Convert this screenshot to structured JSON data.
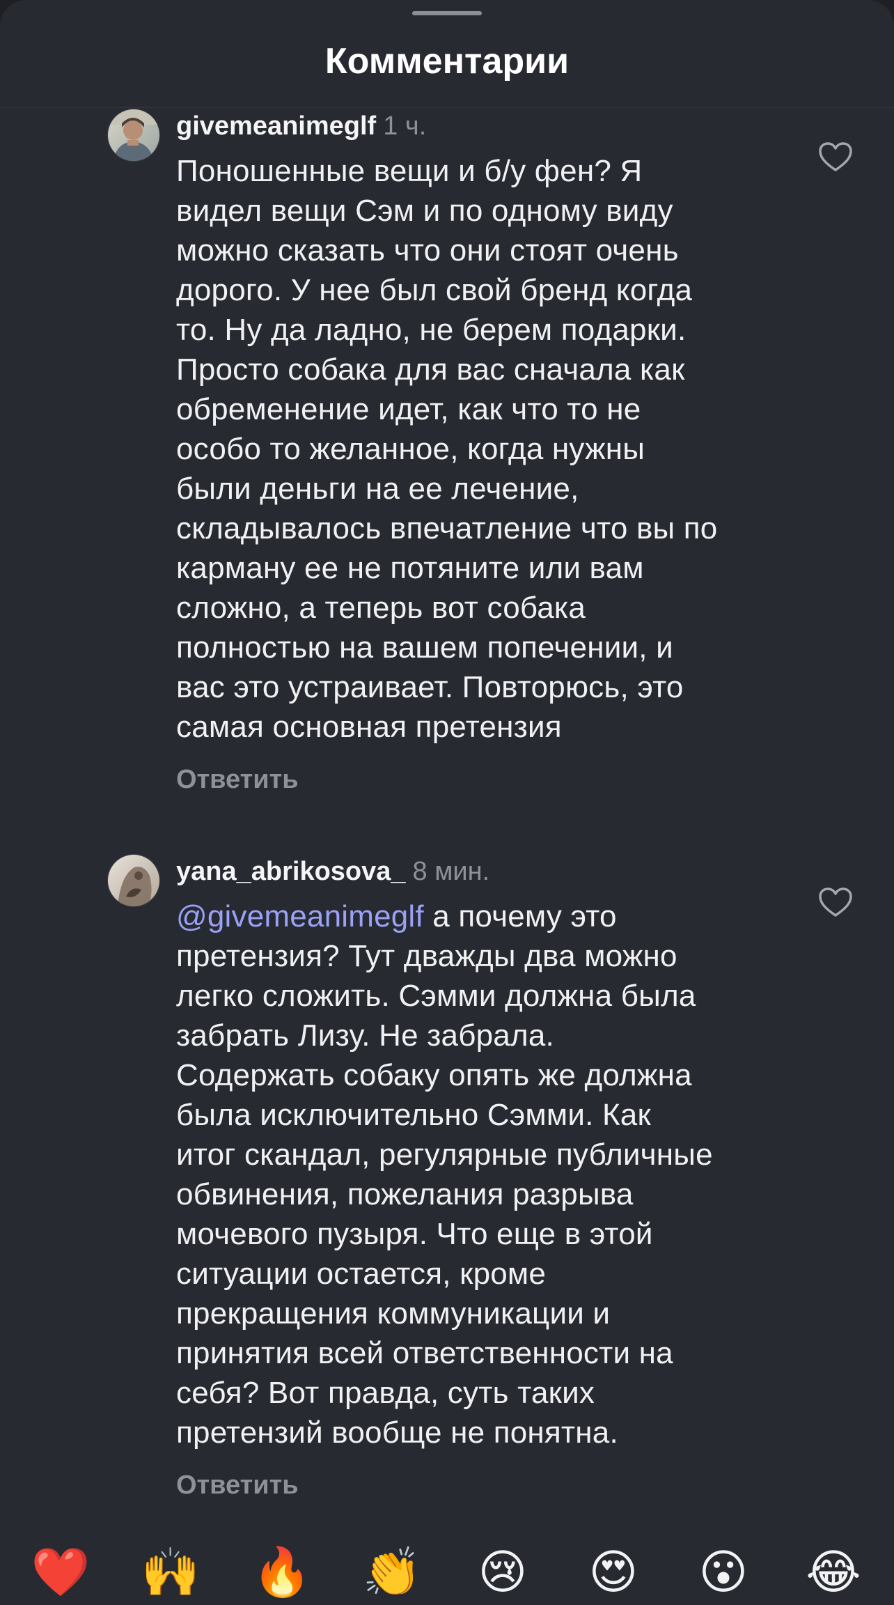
{
  "header": {
    "title": "Комментарии"
  },
  "comments": [
    {
      "username": "givemeanimeglf",
      "time": "1 ч.",
      "mention": "",
      "text": "Поношенные вещи и б/у фен? Я\nвидел вещи Сэм и по одному виду\nможно сказать что они стоят очень\nдорого. У нее был свой бренд когда\nто. Ну да ладно, не берем подарки.\nПросто собака для вас сначала как\nобременение идет, как что то не\nособо то желанное, когда нужны\nбыли деньги на ее лечение,\nскладывалось впечатление что вы по\nкарману ее не потяните или вам\nсложно, а теперь вот собака\nполностью на вашем попечении, и\nвас это устраивает. Повторюсь, это\nсамая основная претензия",
      "reply_label": "Ответить",
      "avatar_icon": "user-avatar-photo"
    },
    {
      "username": "yana_abrikosova_",
      "time": "8 мин.",
      "mention": "@givemeanimeglf",
      "text": " а почему это\nпретензия? Тут дважды два можно\nлегко сложить. Сэмми должна была\nзабрать Лизу. Не забрала.\nСодержать собаку опять же должна\nбыла исключительно Сэмми. Как\nитог скандал, регулярные публичные\nобвинения, пожелания разрыва\nмочевого пузыря. Что еще в этой\nситуации остается, кроме\nпрекращения коммуникации и\nпринятия всей ответственности на\nсебя? Вот правда, суть таких\nпретензий вообще не понятна.",
      "reply_label": "Ответить",
      "avatar_icon": "user-avatar-photo"
    }
  ],
  "reactions": [
    {
      "emoji": "❤️",
      "name": "red-heart"
    },
    {
      "emoji": "🙌",
      "name": "raising-hands"
    },
    {
      "emoji": "🔥",
      "name": "fire"
    },
    {
      "emoji": "👏",
      "name": "clapping-hands"
    },
    {
      "emoji": "😢",
      "name": "crying-face"
    },
    {
      "emoji": "😍",
      "name": "heart-eyes"
    },
    {
      "emoji": "😮",
      "name": "surprised-face"
    },
    {
      "emoji": "😂",
      "name": "tears-of-joy"
    }
  ],
  "colors": {
    "background": "#272a30",
    "text": "#f1f1f3",
    "muted": "#8e9199",
    "mention": "#9aa1f6"
  }
}
